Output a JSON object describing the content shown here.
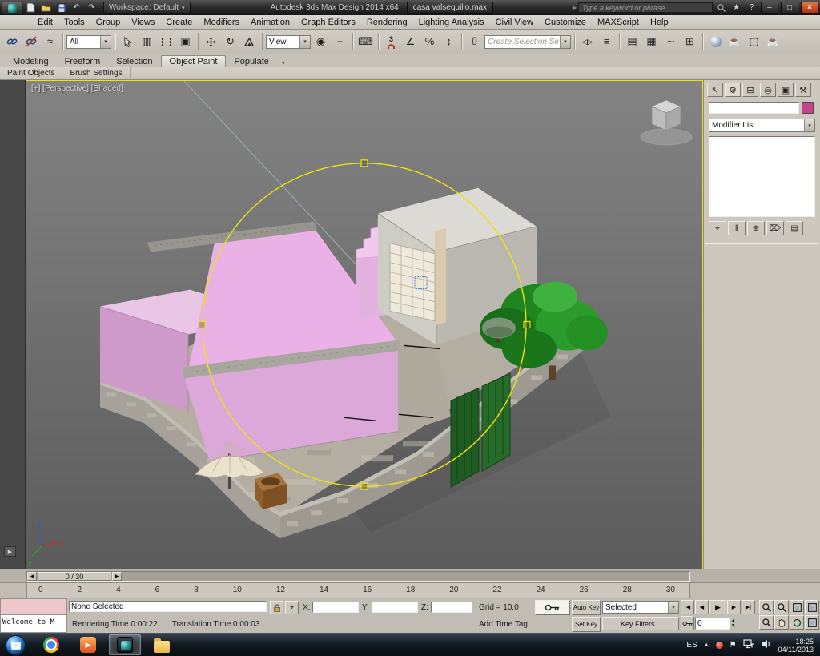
{
  "colors": {
    "viewport_border": "#ece217",
    "gizmo_yellow": "#ece40c",
    "object_color_swatch": "#c8418c"
  },
  "title_bar": {
    "workspace_button": "Workspace: Default",
    "app_title": "Autodesk 3ds Max Design 2014 x64",
    "document_title": "casa valsequillo.max",
    "search_placeholder": "Type a keyword or phrase",
    "minimize_label": "–",
    "maximize_label": "□",
    "close_label": "×",
    "help_label": "?"
  },
  "menu_bar": {
    "items": [
      "Edit",
      "Tools",
      "Group",
      "Views",
      "Create",
      "Modifiers",
      "Animation",
      "Graph Editors",
      "Rendering",
      "Lighting Analysis",
      "Civil View",
      "Customize",
      "MAXScript",
      "Help"
    ]
  },
  "toolbar": {
    "selection_filter_value": "All",
    "coordinate_system_value": "View",
    "named_selection_placeholder": "Create Selection Se",
    "snap_toggle_label": "3",
    "percent_label": "%"
  },
  "ribbon": {
    "tabs": [
      "Modeling",
      "Freeform",
      "Selection",
      "Object Paint",
      "Populate"
    ],
    "active_tab": "Object Paint",
    "panel_tabs": [
      "Paint Objects",
      "Brush Settings"
    ]
  },
  "viewport": {
    "label": "[+] [Perspective] [Shaded]",
    "axis_x": "x",
    "axis_y": "y",
    "axis_z": "z"
  },
  "command_panel": {
    "modifier_list_value": "Modifier List"
  },
  "timeline": {
    "slider_value": "0 / 30",
    "ticks": [
      "0",
      "2",
      "4",
      "6",
      "8",
      "10",
      "12",
      "14",
      "16",
      "18",
      "20",
      "22",
      "24",
      "26",
      "28",
      "30"
    ]
  },
  "status_bar": {
    "listener_line": "Welcome to M",
    "selection_status": "None Selected",
    "x_label": "X:",
    "y_label": "Y:",
    "z_label": "Z:",
    "grid_label": "Grid = 10,0",
    "add_time_tag": "Add Time Tag",
    "rendering_time": "Rendering Time 0:00:22",
    "translation_time": "Translation Time 0:00:03",
    "auto_key_label": "Auto Key",
    "set_key_label": "Set Key",
    "key_filter_scope": "Selected",
    "key_filters_label": "Key Filters...",
    "frame_spinner_value": "0"
  },
  "taskbar": {
    "language": "ES",
    "time": "18:25",
    "date": "04/11/2013"
  },
  "icons": {
    "dropdown_arrow": "▾",
    "undo": "↶",
    "redo": "↷",
    "search_arrow": "▸",
    "star": "★",
    "bind_space_warp": "≈",
    "select_by_name": "▥",
    "window_crossing": "▣",
    "select_rotate": "↻",
    "pivot": "◉",
    "manipulate": "+",
    "keyboard": "⌨",
    "angle": "∠",
    "spinner_snap": "↕",
    "named_sets": "{}",
    "mirror": "◁▷",
    "align": "≡",
    "layers": "▤",
    "ribbon_toggle": "▦",
    "curve_editor": "∼",
    "schematic": "⊞",
    "render_setup": "☕",
    "rendered_frame": "▢",
    "render_production": "☕",
    "cp_create": "↖",
    "cp_modify": "⚙",
    "cp_hierarchy": "⊟",
    "cp_motion": "◎",
    "cp_display": "▣",
    "cp_utilities": "⚒",
    "pin_stack": "⌖",
    "show_end": "‖",
    "make_unique": "⊕",
    "remove_mod": "⌦",
    "config_sets": "▤",
    "time_start": "|◀",
    "time_prev": "◀",
    "time_play": "▶",
    "time_next": "▶",
    "time_end": "▶|",
    "spin_up": "▲",
    "spin_down": "▼",
    "chevron_up": "▲",
    "flag": "⚑",
    "absolute_mode": "⌖",
    "leftstrip": "▶",
    "slider_prev": "◀",
    "slider_next": "▶",
    "media_play": "▶"
  }
}
